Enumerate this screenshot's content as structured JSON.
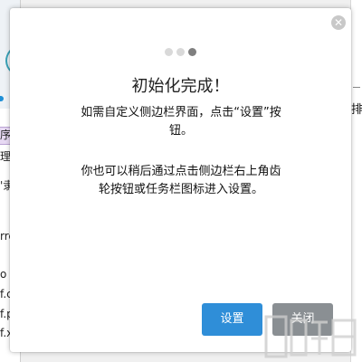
{
  "background": {
    "left_texts": [
      "序",
      "理",
      "'隶",
      "rre",
      "o",
      "f.c",
      "f.p",
      "f.x"
    ],
    "right_text": "排"
  },
  "dialog": {
    "close_glyph": "✕",
    "pager": {
      "total": 3,
      "current": 3
    },
    "title": "初始化完成！",
    "description_1": "如需自定义侧边栏界面，点击“设置”按钮。",
    "description_2": "你也可以稍后通过点击侧边栏右上角齿轮按钮或任务栏图标进入设置。",
    "buttons": {
      "settings": "设置",
      "close": "关闭"
    }
  },
  "colors": {
    "primary_button": "#2f8ed8",
    "secondary_button": "#8a8f93",
    "active_dot": "#7f7f7f",
    "inactive_dot": "#d9d9d9"
  }
}
